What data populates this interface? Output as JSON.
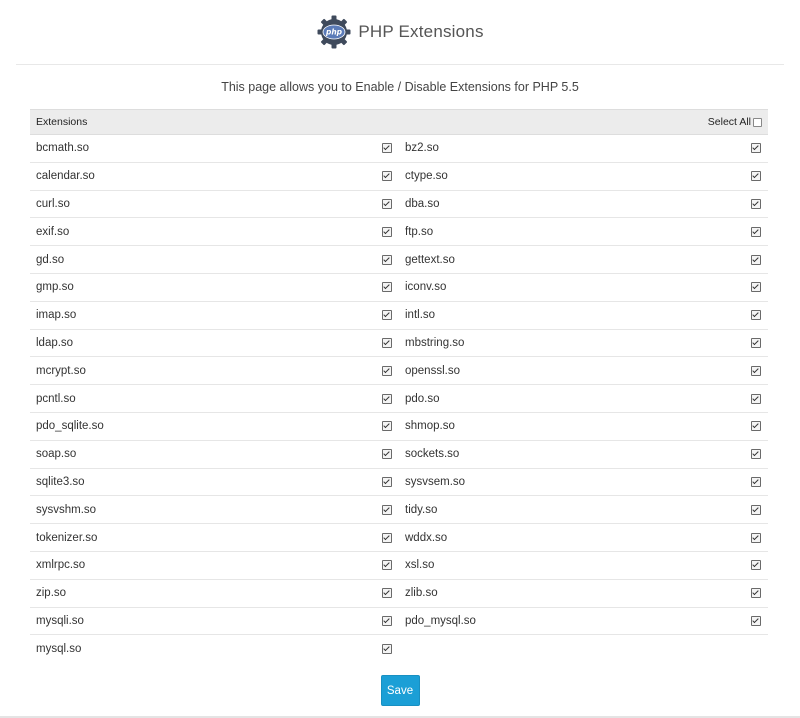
{
  "header": {
    "logo_text": "php",
    "title": "PHP Extensions"
  },
  "intro": "This page allows you to Enable / Disable Extensions for PHP 5.5",
  "table": {
    "column_header": "Extensions",
    "select_all_label": "Select All",
    "select_all_checked": false,
    "rows": [
      [
        {
          "name": "bcmath.so",
          "checked": true
        },
        {
          "name": "bz2.so",
          "checked": true
        }
      ],
      [
        {
          "name": "calendar.so",
          "checked": true
        },
        {
          "name": "ctype.so",
          "checked": true
        }
      ],
      [
        {
          "name": "curl.so",
          "checked": true
        },
        {
          "name": "dba.so",
          "checked": true
        }
      ],
      [
        {
          "name": "exif.so",
          "checked": true
        },
        {
          "name": "ftp.so",
          "checked": true
        }
      ],
      [
        {
          "name": "gd.so",
          "checked": true
        },
        {
          "name": "gettext.so",
          "checked": true
        }
      ],
      [
        {
          "name": "gmp.so",
          "checked": true
        },
        {
          "name": "iconv.so",
          "checked": true
        }
      ],
      [
        {
          "name": "imap.so",
          "checked": true
        },
        {
          "name": "intl.so",
          "checked": true
        }
      ],
      [
        {
          "name": "ldap.so",
          "checked": true
        },
        {
          "name": "mbstring.so",
          "checked": true
        }
      ],
      [
        {
          "name": "mcrypt.so",
          "checked": true
        },
        {
          "name": "openssl.so",
          "checked": true
        }
      ],
      [
        {
          "name": "pcntl.so",
          "checked": true
        },
        {
          "name": "pdo.so",
          "checked": true
        }
      ],
      [
        {
          "name": "pdo_sqlite.so",
          "checked": true
        },
        {
          "name": "shmop.so",
          "checked": true
        }
      ],
      [
        {
          "name": "soap.so",
          "checked": true
        },
        {
          "name": "sockets.so",
          "checked": true
        }
      ],
      [
        {
          "name": "sqlite3.so",
          "checked": true
        },
        {
          "name": "sysvsem.so",
          "checked": true
        }
      ],
      [
        {
          "name": "sysvshm.so",
          "checked": true
        },
        {
          "name": "tidy.so",
          "checked": true
        }
      ],
      [
        {
          "name": "tokenizer.so",
          "checked": true
        },
        {
          "name": "wddx.so",
          "checked": true
        }
      ],
      [
        {
          "name": "xmlrpc.so",
          "checked": true
        },
        {
          "name": "xsl.so",
          "checked": true
        }
      ],
      [
        {
          "name": "zip.so",
          "checked": true
        },
        {
          "name": "zlib.so",
          "checked": true
        }
      ],
      [
        {
          "name": "mysqli.so",
          "checked": true
        },
        {
          "name": "pdo_mysql.so",
          "checked": true
        }
      ],
      [
        {
          "name": "mysql.so",
          "checked": true
        }
      ]
    ]
  },
  "save_label": "Save",
  "colors": {
    "logo_bg": "#3f4a5c",
    "logo_badge": "#5b7bb8",
    "button": "#1b9fd6"
  },
  "icons": {
    "logo": "php-gear-icon",
    "checkbox": "checkbox-checked-icon"
  }
}
